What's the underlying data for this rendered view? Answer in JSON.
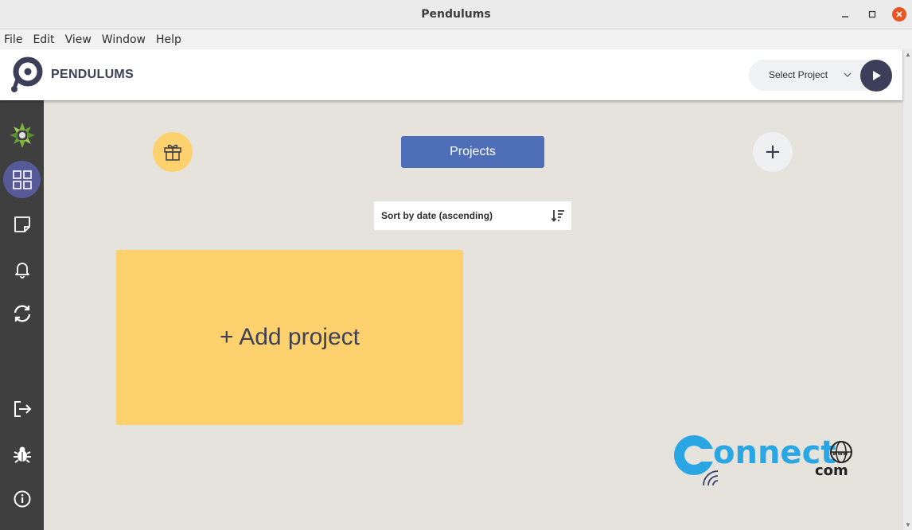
{
  "window": {
    "title": "Pendulums"
  },
  "menu": [
    "File",
    "Edit",
    "View",
    "Window",
    "Help"
  ],
  "header": {
    "brand": "PENDULUMS",
    "project_select": "Select Project"
  },
  "sidebar": {
    "items": [
      {
        "name": "app-logo-icon"
      },
      {
        "name": "projects-grid-icon",
        "active": true
      },
      {
        "name": "notes-icon"
      },
      {
        "name": "bell-icon"
      },
      {
        "name": "sync-icon"
      },
      {
        "name": "logout-icon"
      },
      {
        "name": "bug-icon"
      },
      {
        "name": "info-icon"
      }
    ]
  },
  "main": {
    "projects_button": "Projects",
    "plus_label": "+",
    "sort_label": "Sort by date (ascending)",
    "add_project": "+ Add project"
  },
  "watermark": {
    "word": "onnect",
    "suffix": "com",
    "www": "www"
  },
  "colors": {
    "accent": "#4e6fb8",
    "card": "#fed16f",
    "sidebar": "#3f3f3f",
    "dark": "#3d3f5a"
  }
}
